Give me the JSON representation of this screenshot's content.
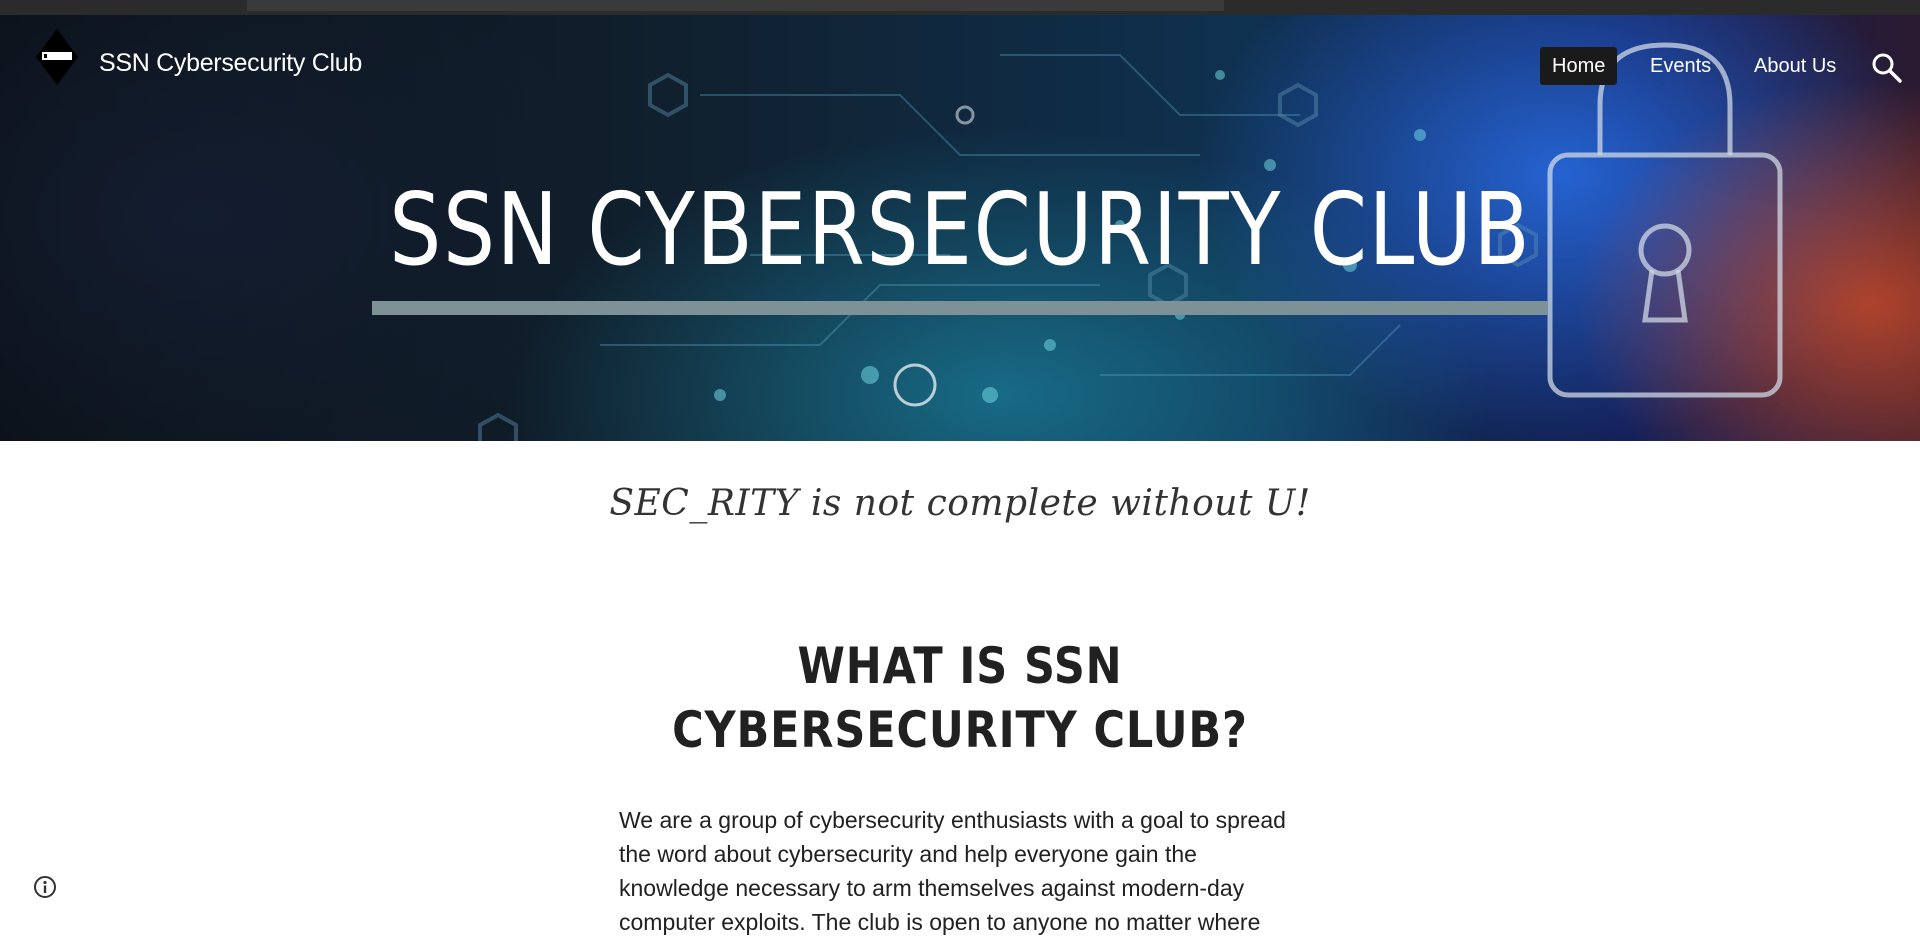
{
  "header": {
    "site_name": "SSN Cybersecurity Club",
    "logo_icon": "club-logo",
    "nav": [
      {
        "label": "Home",
        "active": true
      },
      {
        "label": "Events",
        "active": false
      },
      {
        "label": "About Us",
        "active": false
      }
    ],
    "search_icon": "search-icon"
  },
  "hero": {
    "title": "SSN CYBERSECURITY CLUB"
  },
  "main": {
    "tagline": "SEC_RITY is not complete without U!",
    "section_title": "WHAT IS SSN CYBERSECURITY CLUB?",
    "paragraph": "We are a group of cybersecurity enthusiasts with a goal to spread the word about cybersecurity and help everyone gain the knowledge necessary to arm themselves against modern-day computer exploits. The club is open to anyone no matter where"
  },
  "footer": {
    "info_icon": "info-icon"
  },
  "colors": {
    "accent_rule": "#7e9196",
    "active_nav_bg": "#1a1a1a",
    "text_dark": "#212121"
  }
}
